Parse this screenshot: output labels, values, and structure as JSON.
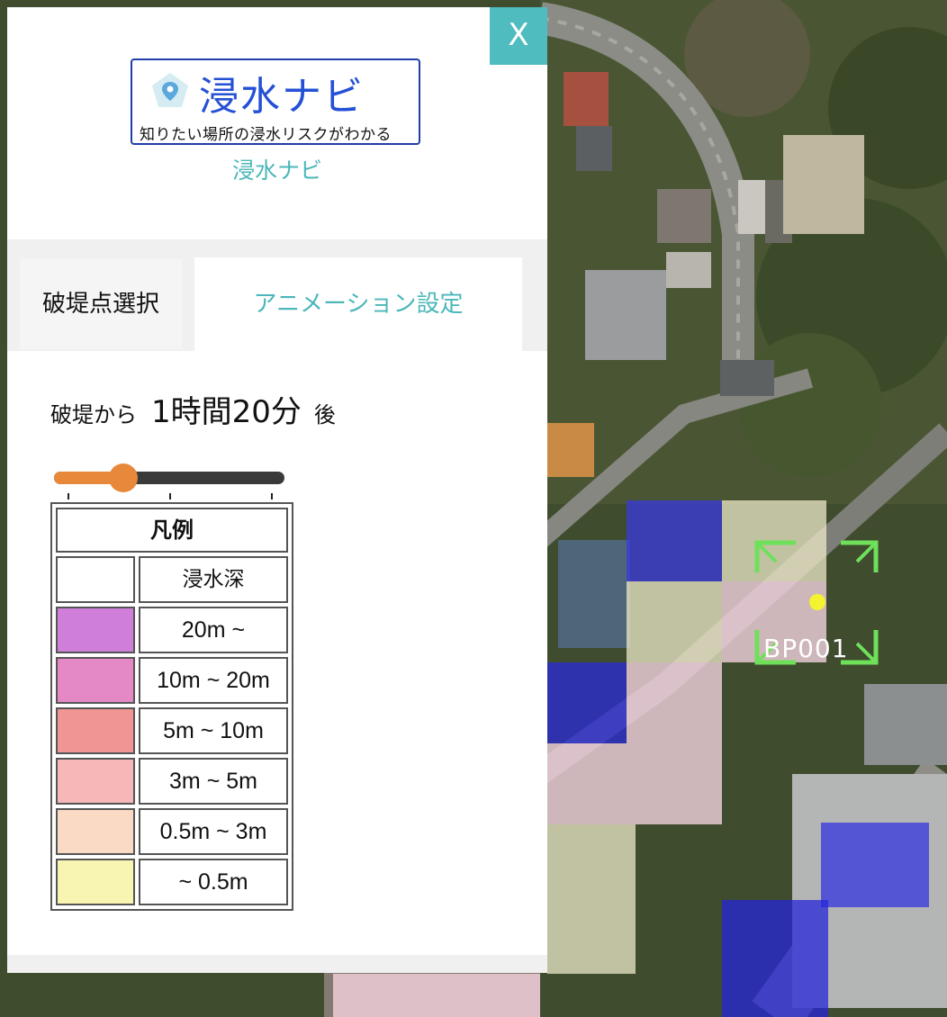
{
  "app": {
    "logo_title": "浸水ナビ",
    "logo_tagline": "知りたい場所の浸水リスクがわかる",
    "name": "浸水ナビ",
    "close_label": "X"
  },
  "tabs": [
    {
      "label": "破堤点選択",
      "active": false
    },
    {
      "label": "アニメーション設定",
      "active": true
    }
  ],
  "animation": {
    "prefix": "破堤から",
    "time": "1時間20分",
    "suffix": "後",
    "slider_position": 0.3
  },
  "legend": {
    "title": "凡例",
    "header": "浸水深",
    "items": [
      {
        "label": "20m ~",
        "color": "#cf7fd9"
      },
      {
        "label": "10m ~ 20m",
        "color": "#e588c6"
      },
      {
        "label": "5m ~ 10m",
        "color": "#f09594"
      },
      {
        "label": "3m ~ 5m",
        "color": "#f5b7b8"
      },
      {
        "label": "0.5m ~ 3m",
        "color": "#fad9c5"
      },
      {
        "label": "~ 0.5m",
        "color": "#f7f5b1"
      }
    ]
  },
  "map": {
    "breach_point_label": "BP001"
  },
  "colors": {
    "accent": "#4fbcbf",
    "slider": "#e8883a",
    "logo_blue": "#2450d6"
  }
}
